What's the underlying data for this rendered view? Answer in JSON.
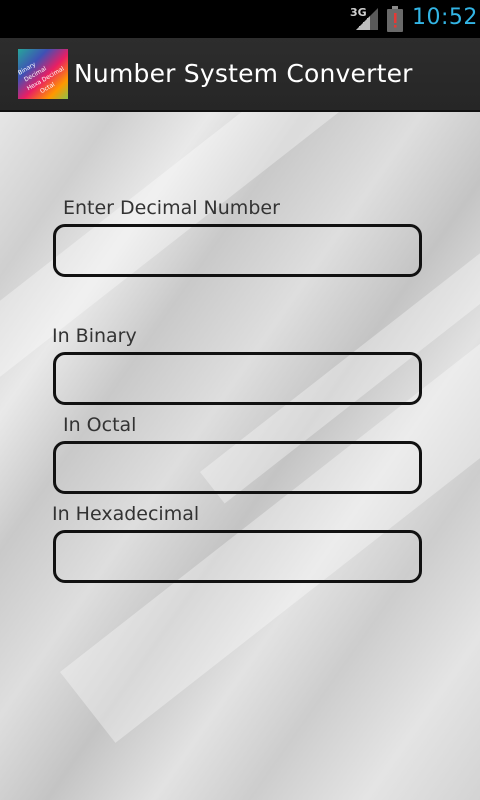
{
  "status_bar": {
    "network_type": "3G",
    "time": "10:52",
    "icons": [
      "signal-icon",
      "battery-alert-icon"
    ]
  },
  "action_bar": {
    "title": "Number System Converter",
    "icon": "app-logo-icon",
    "icon_text": [
      "Binary",
      "Decimal",
      "Hexa Decimal",
      "Octal"
    ]
  },
  "form": {
    "decimal": {
      "label": "Enter Decimal Number",
      "value": ""
    },
    "binary": {
      "label": "In Binary",
      "value": ""
    },
    "octal": {
      "label": "In Octal",
      "value": ""
    },
    "hexadecimal": {
      "label": "In Hexadecimal",
      "value": ""
    }
  },
  "colors": {
    "status_bar": "#000000",
    "clock": "#33b5e5",
    "action_bar": "#2a2a2a",
    "title": "#ffffff",
    "field_border": "#111111"
  }
}
